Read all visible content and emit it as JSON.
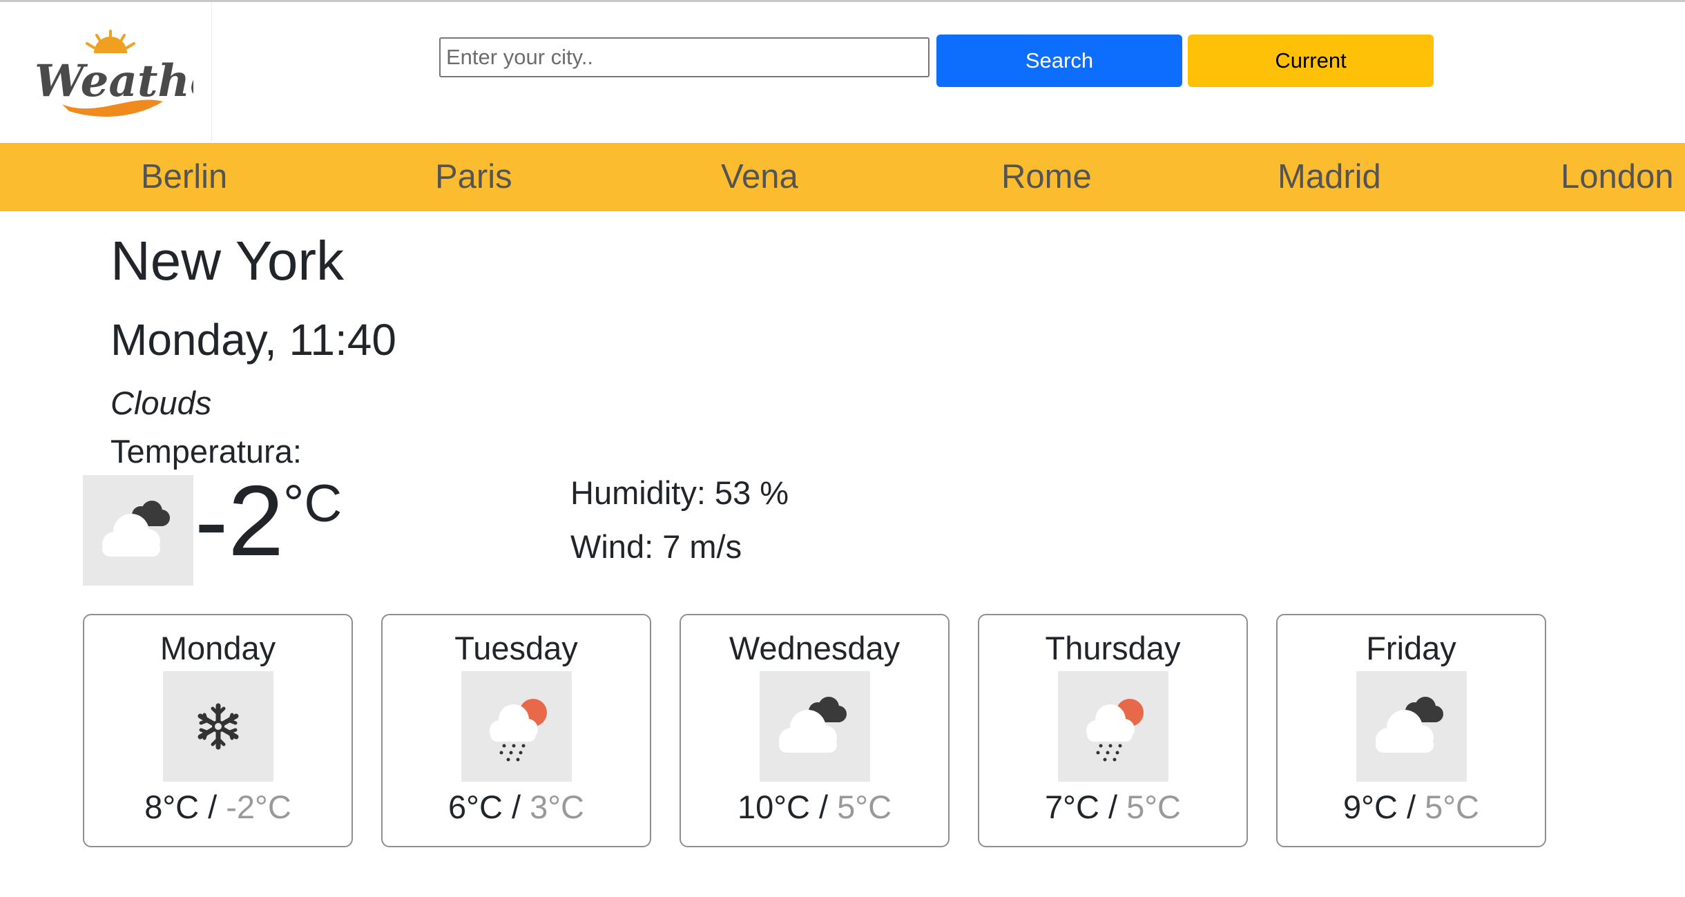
{
  "header": {
    "logo_text": "Weather",
    "search_placeholder": "Enter your city..",
    "search_value": "",
    "search_label": "Search",
    "current_label": "Current"
  },
  "cities": [
    "Berlin",
    "Paris",
    "Vena",
    "Rome",
    "Madrid",
    "London"
  ],
  "current": {
    "city": "New York",
    "datetime": "Monday, 11:40",
    "description": "Clouds",
    "temperature_label": "Temperatura:",
    "temperature": "-2",
    "unit": "°C",
    "humidity": "Humidity: 53 %",
    "wind": "Wind: 7 m/s",
    "icon": "cloudy-night-icon"
  },
  "forecast": [
    {
      "day": "Monday",
      "icon": "snow-icon",
      "max": "8°C",
      "sep": " / ",
      "min": "-2°C"
    },
    {
      "day": "Tuesday",
      "icon": "rain-sun-icon",
      "max": "6°C",
      "sep": " / ",
      "min": "3°C"
    },
    {
      "day": "Wednesday",
      "icon": "cloudy-night-icon",
      "max": "10°C",
      "sep": " / ",
      "min": "5°C"
    },
    {
      "day": "Thursday",
      "icon": "rain-sun-icon",
      "max": "7°C",
      "sep": " / ",
      "min": "5°C"
    },
    {
      "day": "Friday",
      "icon": "cloudy-night-icon",
      "max": "9°C",
      "sep": " / ",
      "min": "5°C"
    }
  ],
  "colors": {
    "city_bar": "#fbbc2f",
    "search_button": "#0d6efd",
    "current_button": "#ffc107",
    "logo_text": "#4a4a4a",
    "logo_swoosh": "#f08a1c",
    "sun": "#e8684a"
  }
}
